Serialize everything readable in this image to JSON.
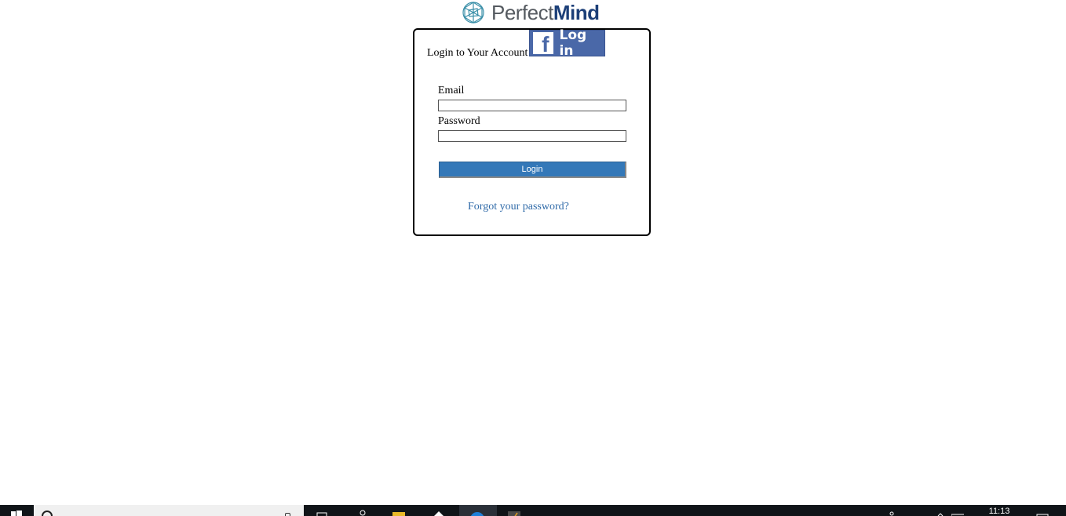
{
  "logo": {
    "part1": "Perfect",
    "part2": "Mind"
  },
  "login": {
    "title": "Login to Your Account",
    "facebook_label": "Log in",
    "email_label": "Email",
    "email_value": "",
    "password_label": "Password",
    "password_value": "",
    "submit_label": "Login",
    "forgot_label": "Forgot your password?"
  },
  "taskbar": {
    "clock_time": "11:13"
  },
  "colors": {
    "brand_dark": "#1c3f78",
    "login_button": "#3478b8",
    "link": "#2f6aa8",
    "facebook": "#4a68a8"
  }
}
